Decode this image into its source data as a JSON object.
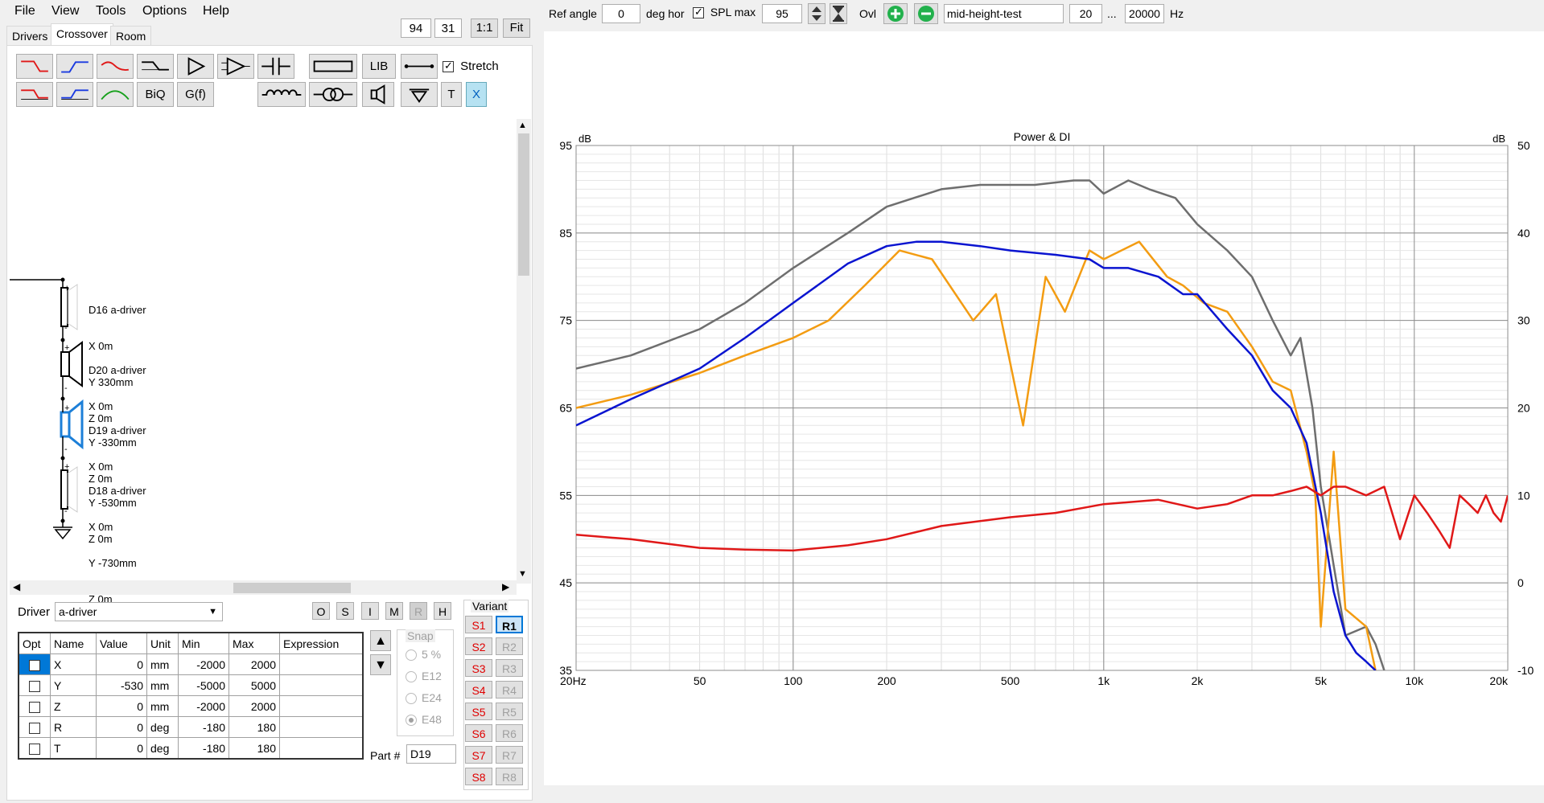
{
  "menu": [
    "File",
    "View",
    "Tools",
    "Options",
    "Help"
  ],
  "toolbar_left": {
    "a": "94",
    "b": "31",
    "one_to_one": "1:1",
    "fit": "Fit"
  },
  "tabs": [
    "Drivers",
    "Crossover",
    "Room"
  ],
  "tools": {
    "lib": "LIB",
    "stretch": "Stretch",
    "biq": "BiQ",
    "gf": "G(f)",
    "t": "T",
    "x": "X"
  },
  "schematic": {
    "drivers": [
      {
        "name": "D16 a-driver",
        "x": "X 0m",
        "y": "Y 330mm",
        "z": "Z 0m"
      },
      {
        "name": "D20 a-driver",
        "x": "X 0m",
        "y": "Y -330mm",
        "z": "Z 0m"
      },
      {
        "name": "D19 a-driver",
        "x": "X 0m",
        "y": "Y -530mm",
        "z": "Z 0m"
      },
      {
        "name": "D18 a-driver",
        "x": "X 0m",
        "y": "Y -730mm",
        "z": "Z 0m"
      }
    ]
  },
  "driver_row": {
    "label": "Driver",
    "selected": "a-driver",
    "buttons": [
      "O",
      "S",
      "I",
      "M",
      "R",
      "H"
    ]
  },
  "params_table": {
    "headers": [
      "Opt",
      "Name",
      "Value",
      "Unit",
      "Min",
      "Max",
      "Expression"
    ],
    "rows": [
      [
        "X",
        "0",
        "mm",
        "-2000",
        "2000",
        ""
      ],
      [
        "Y",
        "-530",
        "mm",
        "-5000",
        "5000",
        ""
      ],
      [
        "Z",
        "0",
        "mm",
        "-2000",
        "2000",
        ""
      ],
      [
        "R",
        "0",
        "deg",
        "-180",
        "180",
        ""
      ],
      [
        "T",
        "0",
        "deg",
        "-180",
        "180",
        ""
      ]
    ]
  },
  "snap": {
    "title": "Snap",
    "options": [
      "5 %",
      "E12",
      "E24",
      "E48"
    ]
  },
  "part": {
    "label": "Part #",
    "value": "D19"
  },
  "variant": {
    "title": "Variant",
    "s": [
      "S1",
      "S2",
      "S3",
      "S4",
      "S5",
      "S6",
      "S7",
      "S8"
    ],
    "r": [
      "R1",
      "R2",
      "R3",
      "R4",
      "R5",
      "R6",
      "R7",
      "R8"
    ]
  },
  "top_right": {
    "ref_angle_label": "Ref angle",
    "ref_angle": "0",
    "deg_hor": "deg hor",
    "spl_max_label": "SPL max",
    "spl_max": "95",
    "ovl": "Ovl",
    "curve_name": "mid-height-test",
    "f_min": "20",
    "ellipsis": "...",
    "f_max": "20000",
    "hz": "Hz"
  },
  "chart_data": {
    "type": "line",
    "title": "Power & DI",
    "x_scale": "log",
    "xlim": [
      20,
      20000
    ],
    "ylim": [
      35,
      95
    ],
    "y2lim": [
      -10,
      50
    ],
    "ylabel": "dB",
    "y2label": "dB",
    "x_ticks": [
      "20Hz",
      "50",
      "100",
      "200",
      "500",
      "1k",
      "2k",
      "5k",
      "10k",
      "20k"
    ],
    "x_tick_values": [
      20,
      50,
      100,
      200,
      500,
      1000,
      2000,
      5000,
      10000,
      20000
    ],
    "y_ticks": [
      "95",
      "85",
      "75",
      "65",
      "55",
      "45",
      "35"
    ],
    "y2_ticks": [
      "50",
      "40",
      "30",
      "20",
      "10",
      "0",
      "-10"
    ],
    "series": [
      {
        "color": "#6e6e6e",
        "x": [
          20,
          30,
          50,
          70,
          100,
          150,
          200,
          300,
          400,
          600,
          800,
          900,
          1000,
          1200,
          1400,
          1700,
          2000,
          2500,
          3000,
          3500,
          4000,
          4300,
          4700,
          5000,
          5500,
          6000,
          7000,
          7500,
          8000
        ],
        "y": [
          69.5,
          71,
          74,
          77,
          81,
          85,
          88,
          90,
          90.5,
          90.5,
          91,
          91,
          89.5,
          91,
          90,
          89,
          86,
          83,
          80,
          75,
          71,
          73,
          65,
          56,
          47,
          39,
          40,
          38,
          35
        ]
      },
      {
        "color": "#f39c12",
        "x": [
          20,
          30,
          50,
          70,
          100,
          130,
          170,
          220,
          280,
          380,
          450,
          550,
          650,
          750,
          900,
          1000,
          1300,
          1600,
          1800,
          2100,
          2500,
          3000,
          3500,
          4000,
          4500,
          4800,
          5000,
          5500,
          6000,
          7000,
          7500
        ],
        "y": [
          65,
          66.5,
          69,
          71,
          73,
          75,
          79,
          83,
          82,
          75,
          78,
          63,
          80,
          76,
          83,
          82,
          84,
          80,
          79,
          77,
          76,
          72,
          68,
          67,
          60,
          55,
          40,
          60,
          42,
          40,
          35
        ]
      },
      {
        "color": "#0a14d0",
        "x": [
          20,
          30,
          50,
          70,
          100,
          150,
          200,
          250,
          300,
          400,
          500,
          700,
          900,
          1000,
          1200,
          1500,
          1800,
          2000,
          2500,
          3000,
          3500,
          4000,
          4500,
          5000,
          5500,
          6000,
          6500,
          7000,
          7500
        ],
        "y": [
          63,
          66,
          69.5,
          73,
          77,
          81.5,
          83.5,
          84,
          84,
          83.5,
          83,
          82.5,
          82,
          81,
          81,
          80,
          78,
          78,
          74,
          71,
          67,
          65,
          61,
          53,
          44,
          39,
          37,
          36,
          35
        ]
      },
      {
        "color": "#e01818",
        "x": [
          20,
          30,
          50,
          70,
          100,
          150,
          200,
          300,
          500,
          700,
          1000,
          1500,
          2000,
          2500,
          3000,
          3500,
          4000,
          4500,
          5000,
          5500,
          6000,
          7000,
          8000,
          9000,
          10000,
          11000,
          12000,
          13000,
          14000,
          15000,
          16000,
          17000,
          18000,
          19000,
          20000
        ],
        "y": [
          50.5,
          50,
          49,
          48.8,
          48.7,
          49.3,
          50,
          51.5,
          52.5,
          53,
          54,
          54.5,
          53.5,
          54,
          55,
          55,
          55.5,
          56,
          55,
          56,
          56,
          55,
          56,
          50,
          55,
          53,
          51,
          49,
          55,
          54,
          53,
          55,
          53,
          52,
          55
        ]
      }
    ]
  }
}
